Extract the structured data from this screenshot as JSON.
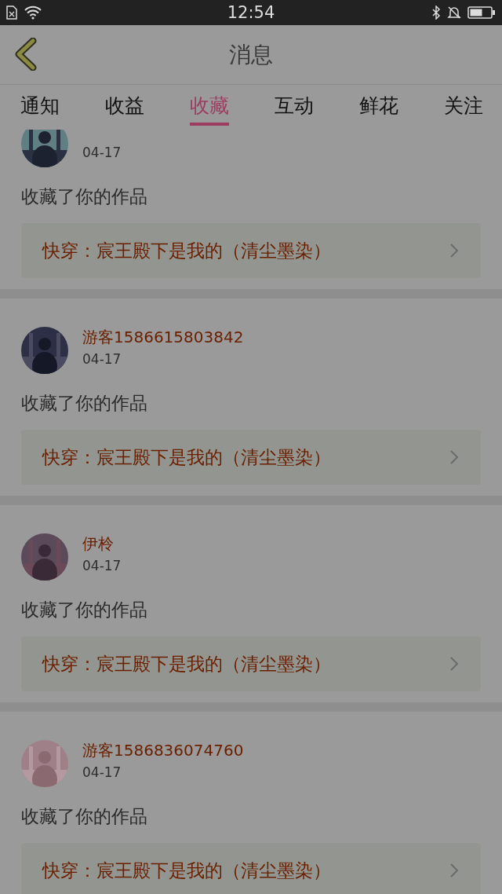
{
  "status_bar": {
    "time": "12:54"
  },
  "header": {
    "title": "消息"
  },
  "tabs": [
    {
      "label": "通知",
      "selected": false
    },
    {
      "label": "收益",
      "selected": false
    },
    {
      "label": "收藏",
      "selected": true
    },
    {
      "label": "互动",
      "selected": false
    },
    {
      "label": "鲜花",
      "selected": false
    },
    {
      "label": "关注",
      "selected": false
    }
  ],
  "messages": [
    {
      "date": "04-17",
      "action": "收藏了你的作品",
      "work": "快穿：宸王殿下是我的（清尘墨染）"
    },
    {
      "user": "游客1586615803842",
      "date": "04-17",
      "action": "收藏了你的作品",
      "work": "快穿：宸王殿下是我的（清尘墨染）"
    },
    {
      "user": "伊柃",
      "date": "04-17",
      "action": "收藏了你的作品",
      "work": "快穿：宸王殿下是我的（清尘墨染）"
    },
    {
      "user": "游客1586836074760",
      "date": "04-17",
      "action": "收藏了你的作品",
      "work": "快穿：宸王殿下是我的（清尘墨染）"
    }
  ]
}
